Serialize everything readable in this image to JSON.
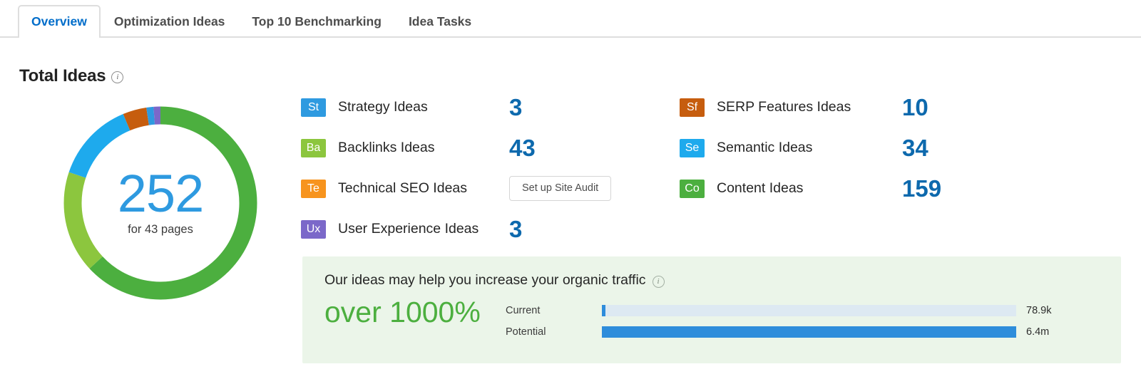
{
  "tabs": [
    {
      "label": "Overview",
      "active": true
    },
    {
      "label": "Optimization Ideas",
      "active": false
    },
    {
      "label": "Top 10 Benchmarking",
      "active": false
    },
    {
      "label": "Idea Tasks",
      "active": false
    }
  ],
  "section": {
    "title": "Total Ideas",
    "info_icon": "info-icon"
  },
  "donut": {
    "total": "252",
    "subtitle": "for 43 pages"
  },
  "categories_left": [
    {
      "badge": "St",
      "badge_color": "#2e9ae0",
      "label": "Strategy Ideas",
      "value": "3",
      "kind": "value"
    },
    {
      "badge": "Ba",
      "badge_color": "#8cc63e",
      "label": "Backlinks Ideas",
      "value": "43",
      "kind": "value"
    },
    {
      "badge": "Te",
      "badge_color": "#f7941e",
      "label": "Technical SEO Ideas",
      "value": "Set up Site Audit",
      "kind": "button"
    },
    {
      "badge": "Ux",
      "badge_color": "#7b68c9",
      "label": "User Experience Ideas",
      "value": "3",
      "kind": "value"
    }
  ],
  "categories_right": [
    {
      "badge": "Sf",
      "badge_color": "#c65d0e",
      "label": "SERP Features Ideas",
      "value": "10",
      "kind": "value"
    },
    {
      "badge": "Se",
      "badge_color": "#1eaaed",
      "label": "Semantic Ideas",
      "value": "34",
      "kind": "value"
    },
    {
      "badge": "Co",
      "badge_color": "#4caf3f",
      "label": "Content Ideas",
      "value": "159",
      "kind": "value"
    }
  ],
  "traffic": {
    "headline": "Our ideas may help you increase your organic traffic",
    "info_icon": "info-icon",
    "percent": "over 1000%",
    "rows": [
      {
        "label": "Current",
        "value": "78.9k",
        "fill_pct": 0.9
      },
      {
        "label": "Potential",
        "value": "6.4m",
        "fill_pct": 100
      }
    ]
  },
  "colors": {
    "accent_blue": "#0d69ad",
    "donut_blue": "#2e9ae0",
    "green": "#4caf3f",
    "panel_green": "#ebf5e9",
    "bar_blue": "#2e8ddb",
    "bar_track": "#dde9f2"
  },
  "chart_data": {
    "type": "pie",
    "title": "Total Ideas",
    "total": 252,
    "subtitle": "for 43 pages",
    "legend_position": "right",
    "categories": [
      "Content Ideas",
      "Backlinks Ideas",
      "Semantic Ideas",
      "SERP Features Ideas",
      "Strategy Ideas",
      "User Experience Ideas"
    ],
    "values": [
      159,
      43,
      34,
      10,
      3,
      3
    ],
    "colors": [
      "#4caf3f",
      "#8cc63e",
      "#1eaaed",
      "#c65d0e",
      "#2e9ae0",
      "#7b68c9"
    ],
    "xlabel": "",
    "ylabel": ""
  },
  "chart_data_bars": {
    "type": "bar",
    "orientation": "horizontal",
    "categories": [
      "Current",
      "Potential"
    ],
    "values": [
      78900,
      6400000
    ],
    "value_labels": [
      "78.9k",
      "6.4m"
    ],
    "title": "Our ideas may help you increase your organic traffic",
    "annotation": "over 1000%",
    "grid": false,
    "xlabel": "",
    "ylabel": ""
  }
}
